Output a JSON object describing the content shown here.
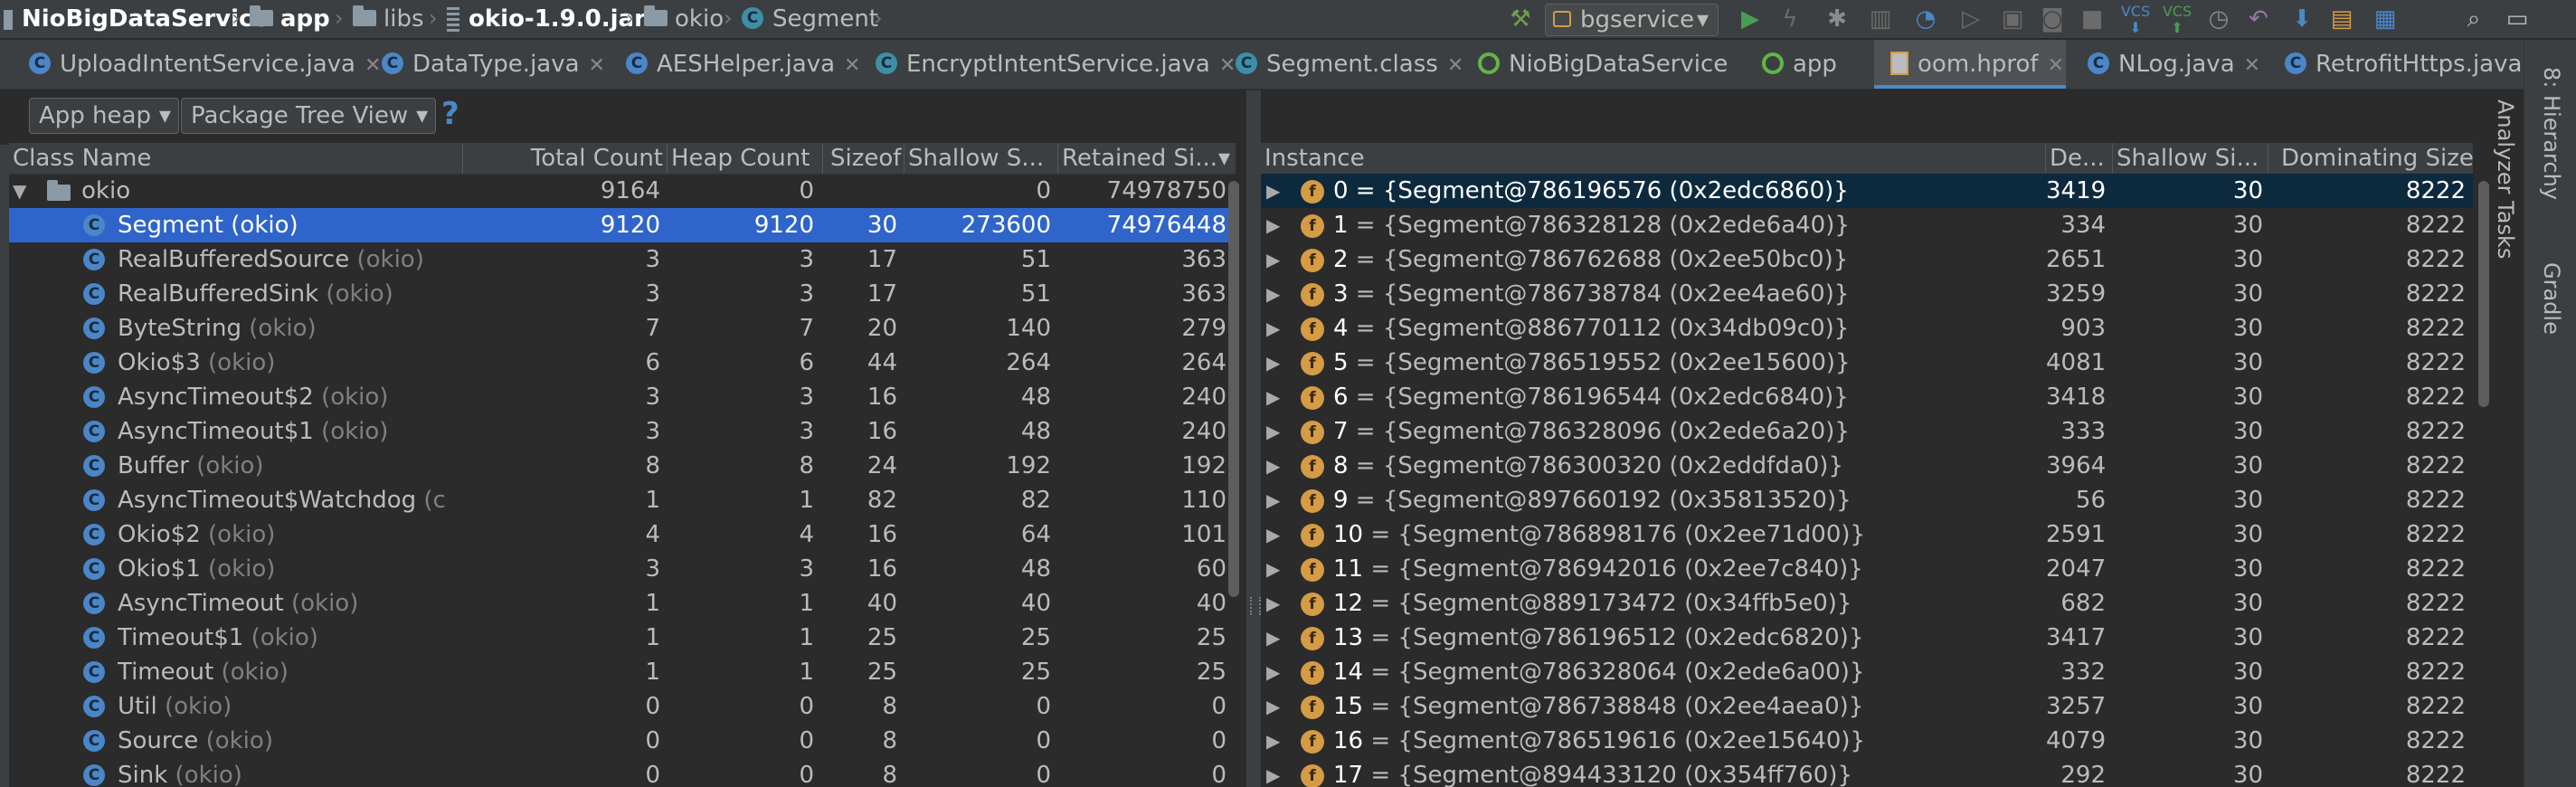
{
  "nav": {
    "project": "NioBigDataService",
    "crumbs": [
      "app",
      "libs",
      "okio-1.9.0.jar",
      "okio",
      "Segment"
    ],
    "run_config": "bgservice"
  },
  "tabs": [
    {
      "label": "UploadIntentService.java",
      "icon": "class-icon"
    },
    {
      "label": "DataType.java",
      "icon": "class-icon"
    },
    {
      "label": "AESHelper.java",
      "icon": "class-icon"
    },
    {
      "label": "EncryptIntentService.java",
      "icon": "class-icon"
    },
    {
      "label": "Segment.class",
      "icon": "class-icon"
    },
    {
      "label": "NioBigDataService",
      "icon": "app-icon"
    },
    {
      "label": "app",
      "icon": "app-icon"
    },
    {
      "label": "oom.hprof",
      "icon": "hprof-icon",
      "active": true
    },
    {
      "label": "NLog.java",
      "icon": "class-icon"
    },
    {
      "label": "RetrofitHttps.java",
      "icon": "class-icon"
    }
  ],
  "toolbar": {
    "heap": "App heap",
    "view": "Package Tree View",
    "help": "?"
  },
  "left_table": {
    "headers": [
      "Class Name",
      "Total Count",
      "Heap Count",
      "Sizeof",
      "Shallow S...",
      "Retained Si..."
    ],
    "rows": [
      {
        "name": "okio",
        "pkg": "",
        "total": "9164",
        "heap": "0",
        "sizeof": "",
        "shallow": "0",
        "retained": "74978750",
        "level": 0
      },
      {
        "name": "Segment",
        "pkg": "(okio)",
        "total": "9120",
        "heap": "9120",
        "sizeof": "30",
        "shallow": "273600",
        "retained": "74976448",
        "level": 1,
        "selected": true
      },
      {
        "name": "RealBufferedSource",
        "pkg": "(okio)",
        "total": "3",
        "heap": "3",
        "sizeof": "17",
        "shallow": "51",
        "retained": "363",
        "level": 1
      },
      {
        "name": "RealBufferedSink",
        "pkg": "(okio)",
        "total": "3",
        "heap": "3",
        "sizeof": "17",
        "shallow": "51",
        "retained": "363",
        "level": 1
      },
      {
        "name": "ByteString",
        "pkg": "(okio)",
        "total": "7",
        "heap": "7",
        "sizeof": "20",
        "shallow": "140",
        "retained": "279",
        "level": 1
      },
      {
        "name": "Okio$3",
        "pkg": "(okio)",
        "total": "6",
        "heap": "6",
        "sizeof": "44",
        "shallow": "264",
        "retained": "264",
        "level": 1
      },
      {
        "name": "AsyncTimeout$2",
        "pkg": "(okio)",
        "total": "3",
        "heap": "3",
        "sizeof": "16",
        "shallow": "48",
        "retained": "240",
        "level": 1
      },
      {
        "name": "AsyncTimeout$1",
        "pkg": "(okio)",
        "total": "3",
        "heap": "3",
        "sizeof": "16",
        "shallow": "48",
        "retained": "240",
        "level": 1
      },
      {
        "name": "Buffer",
        "pkg": "(okio)",
        "total": "8",
        "heap": "8",
        "sizeof": "24",
        "shallow": "192",
        "retained": "192",
        "level": 1
      },
      {
        "name": "AsyncTimeout$Watchdog",
        "pkg": "(c",
        "total": "1",
        "heap": "1",
        "sizeof": "82",
        "shallow": "82",
        "retained": "110",
        "level": 1
      },
      {
        "name": "Okio$2",
        "pkg": "(okio)",
        "total": "4",
        "heap": "4",
        "sizeof": "16",
        "shallow": "64",
        "retained": "101",
        "level": 1
      },
      {
        "name": "Okio$1",
        "pkg": "(okio)",
        "total": "3",
        "heap": "3",
        "sizeof": "16",
        "shallow": "48",
        "retained": "60",
        "level": 1
      },
      {
        "name": "AsyncTimeout",
        "pkg": "(okio)",
        "total": "1",
        "heap": "1",
        "sizeof": "40",
        "shallow": "40",
        "retained": "40",
        "level": 1
      },
      {
        "name": "Timeout$1",
        "pkg": "(okio)",
        "total": "1",
        "heap": "1",
        "sizeof": "25",
        "shallow": "25",
        "retained": "25",
        "level": 1
      },
      {
        "name": "Timeout",
        "pkg": "(okio)",
        "total": "1",
        "heap": "1",
        "sizeof": "25",
        "shallow": "25",
        "retained": "25",
        "level": 1
      },
      {
        "name": "Util",
        "pkg": "(okio)",
        "total": "0",
        "heap": "0",
        "sizeof": "8",
        "shallow": "0",
        "retained": "0",
        "level": 1
      },
      {
        "name": "Source",
        "pkg": "(okio)",
        "total": "0",
        "heap": "0",
        "sizeof": "8",
        "shallow": "0",
        "retained": "0",
        "level": 1
      },
      {
        "name": "Sink",
        "pkg": "(okio)",
        "total": "0",
        "heap": "0",
        "sizeof": "8",
        "shallow": "0",
        "retained": "0",
        "level": 1
      }
    ]
  },
  "right_table": {
    "headers": [
      "Instance",
      "De...",
      "Shallow Si...",
      "Dominating Size"
    ],
    "rows": [
      {
        "idx": "0",
        "text": " = {Segment@786196576 (0x2edc6860)}",
        "depth": "3419",
        "shallow": "30",
        "dominating": "8222",
        "selected": true
      },
      {
        "idx": "1",
        "text": " = {Segment@786328128 (0x2ede6a40)}",
        "depth": "334",
        "shallow": "30",
        "dominating": "8222"
      },
      {
        "idx": "2",
        "text": " = {Segment@786762688 (0x2ee50bc0)}",
        "depth": "2651",
        "shallow": "30",
        "dominating": "8222"
      },
      {
        "idx": "3",
        "text": " = {Segment@786738784 (0x2ee4ae60)}",
        "depth": "3259",
        "shallow": "30",
        "dominating": "8222"
      },
      {
        "idx": "4",
        "text": " = {Segment@886770112 (0x34db09c0)}",
        "depth": "903",
        "shallow": "30",
        "dominating": "8222"
      },
      {
        "idx": "5",
        "text": " = {Segment@786519552 (0x2ee15600)}",
        "depth": "4081",
        "shallow": "30",
        "dominating": "8222"
      },
      {
        "idx": "6",
        "text": " = {Segment@786196544 (0x2edc6840)}",
        "depth": "3418",
        "shallow": "30",
        "dominating": "8222"
      },
      {
        "idx": "7",
        "text": " = {Segment@786328096 (0x2ede6a20)}",
        "depth": "333",
        "shallow": "30",
        "dominating": "8222"
      },
      {
        "idx": "8",
        "text": " = {Segment@786300320 (0x2eddfda0)}",
        "depth": "3964",
        "shallow": "30",
        "dominating": "8222"
      },
      {
        "idx": "9",
        "text": " = {Segment@897660192 (0x35813520)}",
        "depth": "56",
        "shallow": "30",
        "dominating": "8222"
      },
      {
        "idx": "10",
        "text": " = {Segment@786898176 (0x2ee71d00)}",
        "depth": "2591",
        "shallow": "30",
        "dominating": "8222"
      },
      {
        "idx": "11",
        "text": " = {Segment@786942016 (0x2ee7c840)}",
        "depth": "2047",
        "shallow": "30",
        "dominating": "8222"
      },
      {
        "idx": "12",
        "text": " = {Segment@889173472 (0x34ffb5e0)}",
        "depth": "682",
        "shallow": "30",
        "dominating": "8222"
      },
      {
        "idx": "13",
        "text": " = {Segment@786196512 (0x2edc6820)}",
        "depth": "3417",
        "shallow": "30",
        "dominating": "8222"
      },
      {
        "idx": "14",
        "text": " = {Segment@786328064 (0x2ede6a00)}",
        "depth": "332",
        "shallow": "30",
        "dominating": "8222"
      },
      {
        "idx": "15",
        "text": " = {Segment@786738848 (0x2ee4aea0)}",
        "depth": "3257",
        "shallow": "30",
        "dominating": "8222"
      },
      {
        "idx": "16",
        "text": " = {Segment@786519616 (0x2ee15640)}",
        "depth": "4079",
        "shallow": "30",
        "dominating": "8222"
      },
      {
        "idx": "17",
        "text": " = {Segment@894433120 (0x354ff760)}",
        "depth": "292",
        "shallow": "30",
        "dominating": "8222"
      }
    ]
  },
  "side_panels": {
    "hierarchy": "8: Hierarchy",
    "analyzer": "Analyzer Tasks",
    "gradle": "Gradle"
  },
  "colors": {
    "background": "#2b2b2b",
    "panel": "#3c3f41",
    "selection": "#2f65ca",
    "selection_inactive": "#0d293e",
    "class_icon": "#4a86c8",
    "field_badge": "#d59b45",
    "run_green": "#499c54"
  }
}
